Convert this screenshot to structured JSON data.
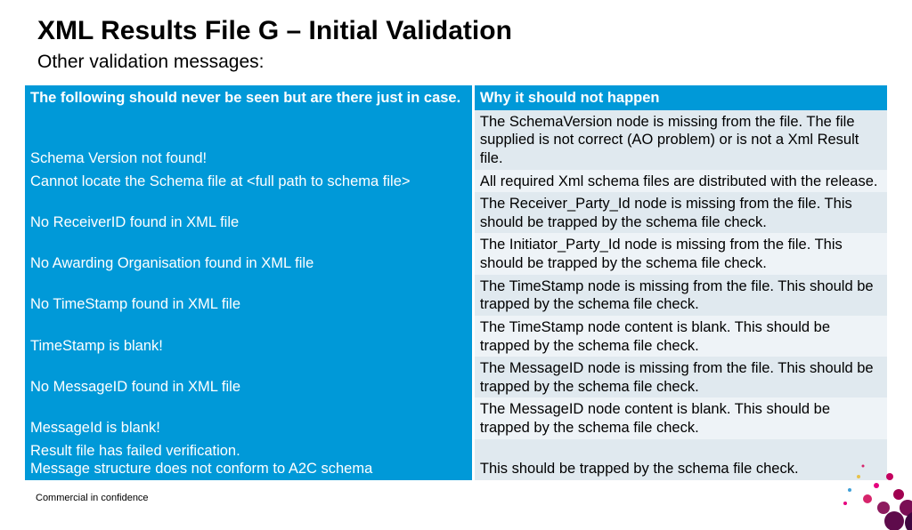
{
  "title": "XML Results File G – Initial Validation",
  "subtitle": "Other validation messages:",
  "footer": "Commercial in confidence",
  "table": {
    "header_left": "The following should never be seen but are there just in case.",
    "header_right": "Why it should not happen",
    "rows": [
      {
        "left": "Schema Version not found!",
        "right": "The SchemaVersion node is missing from the file.  The file supplied is not correct (AO problem) or is not a Xml Result file."
      },
      {
        "left": "Cannot locate the Schema file at <full path to schema file>",
        "right": "All required Xml schema files are distributed with the release."
      },
      {
        "left": "No ReceiverID found in XML file",
        "right": "The Receiver_Party_Id node is missing from the file.  This should be trapped by the schema file check."
      },
      {
        "left": "No Awarding Organisation found in XML file",
        "right": "The Initiator_Party_Id node is missing from the file.  This should be trapped by the schema file check."
      },
      {
        "left": "No TimeStamp found in XML file",
        "right": "The TimeStamp node is missing from the file.  This should be trapped by the schema file check."
      },
      {
        "left": "TimeStamp is blank!",
        "right": "The TimeStamp node content is blank.  This should be trapped by the schema file check."
      },
      {
        "left": "No MessageID found in XML file",
        "right": "The MessageID node is missing from the file.  This should be trapped by the schema file check."
      },
      {
        "left": "MessageId is blank!",
        "right": "The MessageID node content is blank.  This should be trapped by the schema file check."
      },
      {
        "left": "Result file has failed verification.\nMessage structure does not conform to A2C schema",
        "right": "This should be trapped by the schema file check."
      }
    ]
  }
}
